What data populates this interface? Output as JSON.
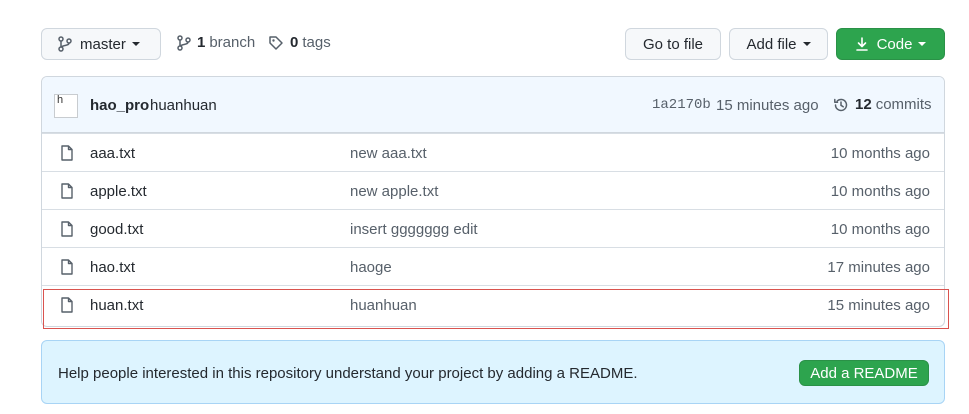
{
  "toolbar": {
    "branch_label": "master",
    "branches_count": "1",
    "branches_label": "branch",
    "tags_count": "0",
    "tags_label": "tags",
    "go_to_file": "Go to file",
    "add_file": "Add file",
    "code": "Code"
  },
  "latest_commit": {
    "avatar_alt": "h",
    "author": "hao_pro",
    "message": "huanhuan",
    "sha": "1a2170b",
    "time": "15 minutes ago",
    "commits_count": "12",
    "commits_label": "commits"
  },
  "files": [
    {
      "name": "aaa.txt",
      "message": "new aaa.txt",
      "age": "10 months ago"
    },
    {
      "name": "apple.txt",
      "message": "new apple.txt",
      "age": "10 months ago"
    },
    {
      "name": "good.txt",
      "message": "insert ggggggg edit",
      "age": "10 months ago"
    },
    {
      "name": "hao.txt",
      "message": "haoge",
      "age": "17 minutes ago"
    },
    {
      "name": "huan.txt",
      "message": "huanhuan",
      "age": "15 minutes ago"
    }
  ],
  "readme_prompt": {
    "text": "Help people interested in this repository understand your project by adding a README.",
    "button": "Add a README"
  },
  "colors": {
    "primary_green": "#2da44e",
    "commit_bar_bg": "#f1f8ff",
    "readme_bg": "#ddf4ff",
    "highlight_border": "#d9534f"
  },
  "icons": [
    "git-branch-icon",
    "tag-icon",
    "download-icon",
    "history-icon",
    "file-icon"
  ]
}
